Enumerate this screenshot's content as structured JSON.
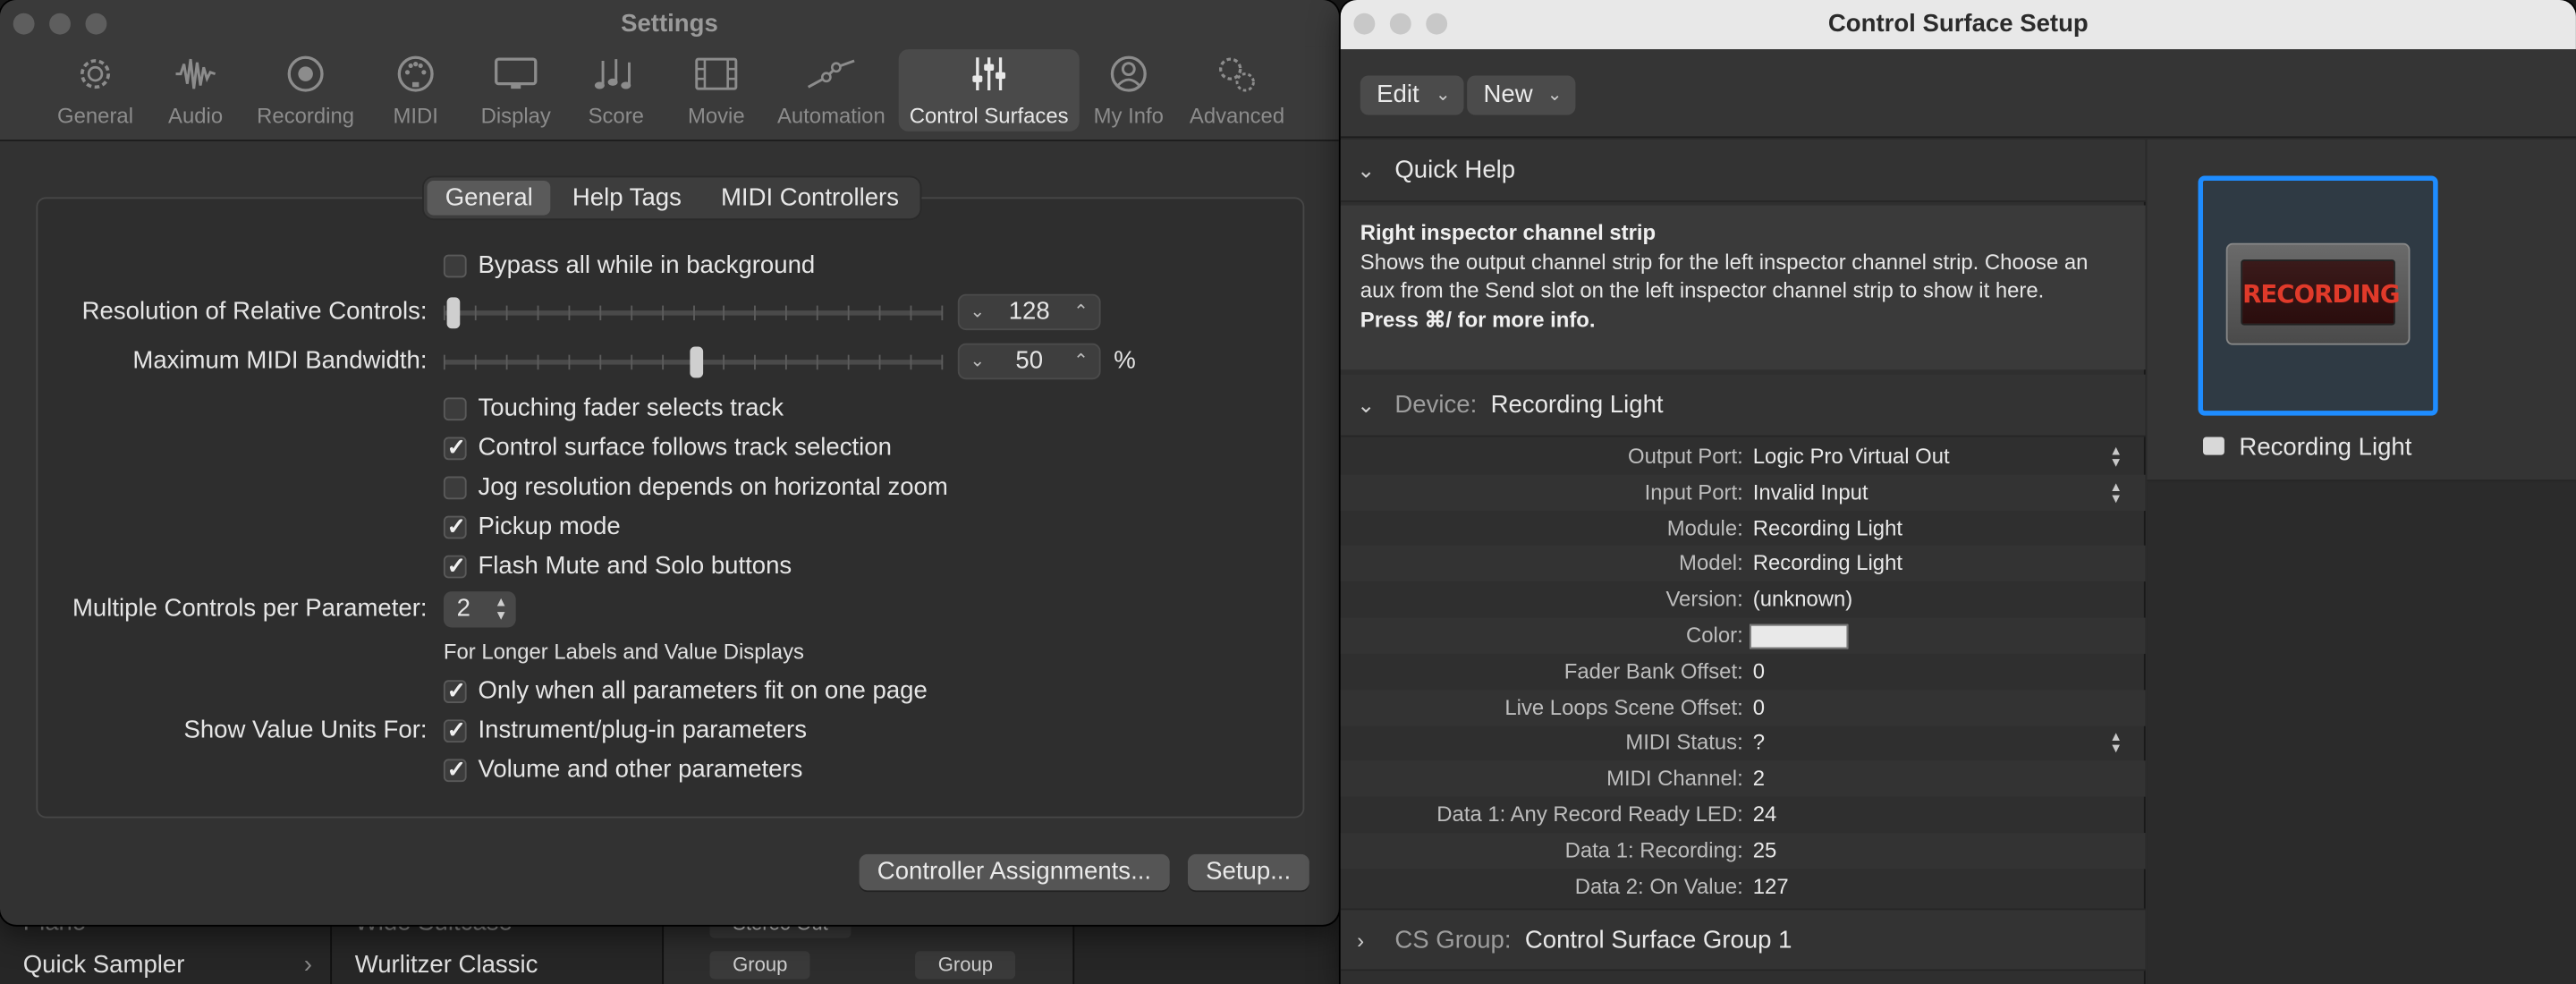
{
  "background": {
    "instrument_1": "Piano",
    "instrument_2": "Quick Sampler",
    "patch_1": "Wide Suitcase",
    "patch_2": "Wurlitzer Classic",
    "output_label": "Stereo Out",
    "group_label_1": "Group",
    "group_label_2": "Group"
  },
  "settings": {
    "title": "Settings",
    "toolbar": [
      {
        "label": "General",
        "icon": "gear-icon"
      },
      {
        "label": "Audio",
        "icon": "waveform-icon"
      },
      {
        "label": "Recording",
        "icon": "record-icon"
      },
      {
        "label": "MIDI",
        "icon": "midi-port-icon"
      },
      {
        "label": "Display",
        "icon": "monitor-icon"
      },
      {
        "label": "Score",
        "icon": "music-notes-icon"
      },
      {
        "label": "Movie",
        "icon": "film-icon"
      },
      {
        "label": "Automation",
        "icon": "automation-curve-icon"
      },
      {
        "label": "Control Surfaces",
        "icon": "faders-icon"
      },
      {
        "label": "My Info",
        "icon": "person-icon"
      },
      {
        "label": "Advanced",
        "icon": "gears-icon"
      }
    ],
    "tabs": [
      "General",
      "Help Tags",
      "MIDI Controllers"
    ],
    "bypass_label": "Bypass all while in background",
    "resolution_label": "Resolution of Relative Controls:",
    "resolution_value": "128",
    "resolution_fraction": 0.0,
    "bandwidth_label": "Maximum MIDI Bandwidth:",
    "bandwidth_value": "50",
    "bandwidth_unit": "%",
    "bandwidth_fraction": 0.5,
    "touching_label": "Touching fader selects track",
    "follows_label": "Control surface follows track selection",
    "jog_label": "Jog resolution depends on horizontal zoom",
    "pickup_label": "Pickup mode",
    "flash_label": "Flash Mute and Solo buttons",
    "multiple_label": "Multiple Controls per Parameter:",
    "multiple_value": "2",
    "longer_note": "For Longer Labels and Value Displays",
    "only_when_label": "Only when all parameters fit on one page",
    "show_units_label": "Show Value Units For:",
    "instrument_label": "Instrument/plug-in parameters",
    "volume_label": "Volume and other parameters",
    "assignments_button": "Controller Assignments...",
    "setup_button": "Setup..."
  },
  "cs": {
    "title": "Control Surface Setup",
    "edit_menu": "Edit",
    "new_menu": "New",
    "quick_help_title": "Quick Help",
    "help_heading": "Right inspector channel strip",
    "help_body": "Shows the output channel strip for the left inspector channel strip. Choose an aux from the Send slot on the left inspector channel strip to show it here.",
    "help_footer": "Press ⌘/ for more info.",
    "device_label": "Device:",
    "device_name": "Recording Light",
    "params": [
      {
        "label": "Output Port:",
        "value": "Logic Pro Virtual Out"
      },
      {
        "label": "Input Port:",
        "value": "Invalid Input"
      },
      {
        "label": "Module:",
        "value": "Recording Light"
      },
      {
        "label": "Model:",
        "value": "Recording Light"
      },
      {
        "label": "Version:",
        "value": "(unknown)"
      },
      {
        "label": "Color:",
        "value": ""
      },
      {
        "label": "Fader Bank Offset:",
        "value": "0"
      },
      {
        "label": "Live Loops Scene Offset:",
        "value": "0"
      },
      {
        "label": "MIDI Status:",
        "value": "?"
      },
      {
        "label": "MIDI Channel:",
        "value": "2"
      },
      {
        "label": "Data 1: Any Record Ready LED:",
        "value": "24"
      },
      {
        "label": "Data 1: Recording:",
        "value": "25"
      },
      {
        "label": "Data 2: On Value:",
        "value": "127"
      }
    ],
    "cs_group_label": "CS Group:",
    "cs_group_name": "Control Surface Group 1",
    "device_tile_screen": "RECORDING",
    "device_tile_label": "Recording Light",
    "accent_color": "#1e8cff"
  }
}
